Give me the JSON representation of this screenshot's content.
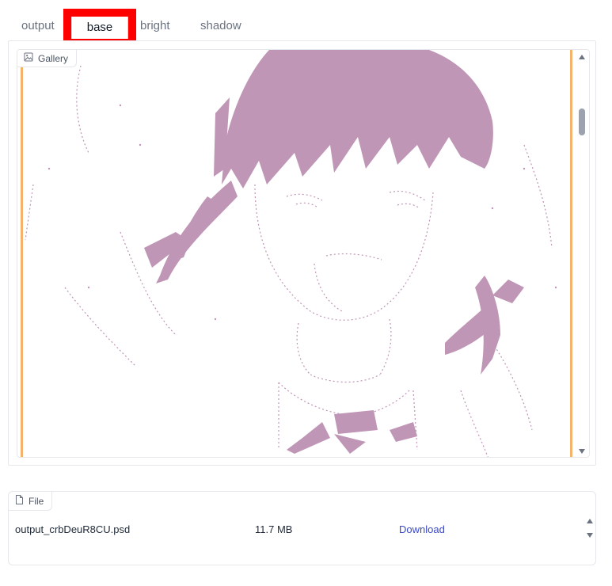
{
  "tabs": [
    {
      "label": "output"
    },
    {
      "label": "base"
    },
    {
      "label": "bright"
    },
    {
      "label": "shadow"
    }
  ],
  "selected_tab": "base",
  "gallery": {
    "label": "Gallery",
    "icon": "image-icon"
  },
  "file_panel": {
    "label": "File",
    "icon": "file-icon",
    "files": [
      {
        "name": "output_crbDeuR8CU.psd",
        "size": "11.7 MB",
        "action": "Download"
      }
    ]
  },
  "colors": {
    "highlight": "#ff0000",
    "accent_bar": "#f5b26b",
    "line_art": "#c096b6",
    "link": "#3b49c4"
  }
}
